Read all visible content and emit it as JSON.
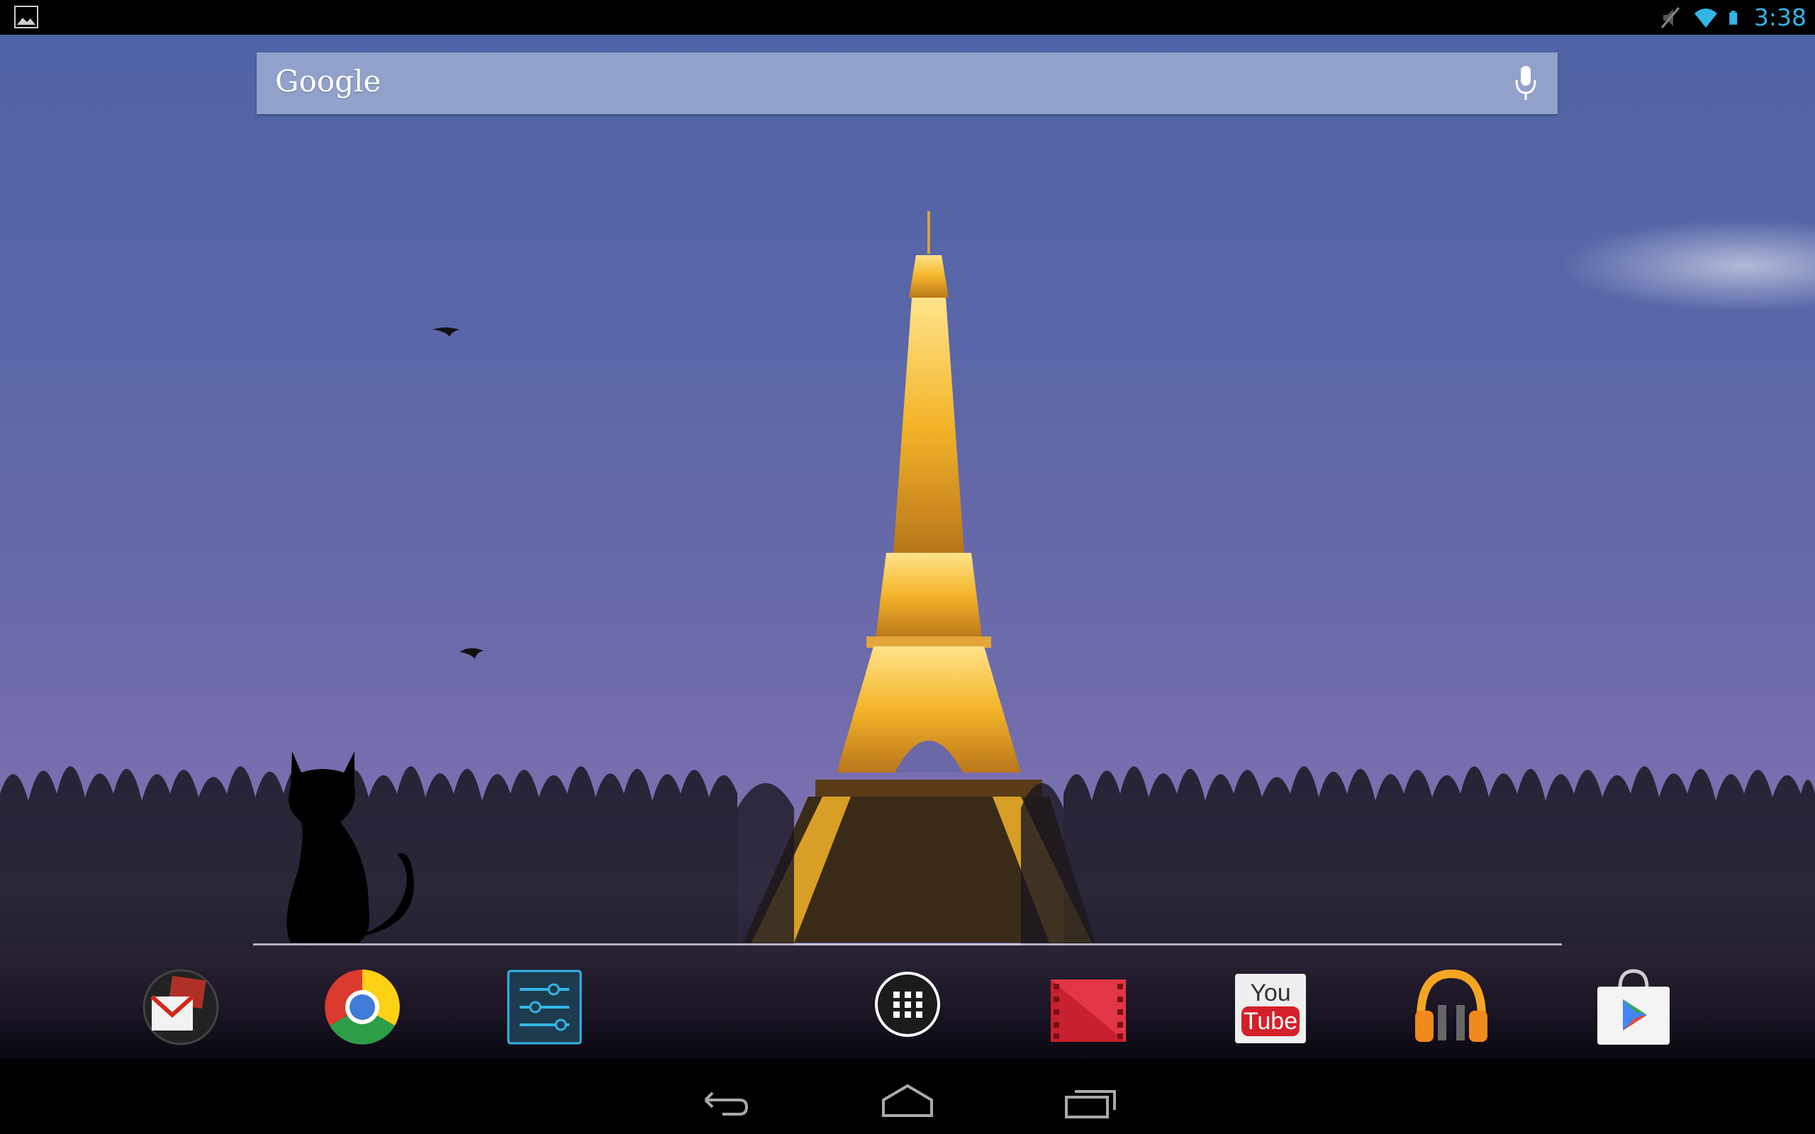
{
  "status_bar": {
    "time": "3:38",
    "icons": [
      "picture-notification-icon",
      "mute-icon",
      "wifi-icon",
      "battery-icon"
    ],
    "clock_color": "#33b5e5"
  },
  "search": {
    "logo_text": "Google",
    "icon": "mic-icon"
  },
  "dock": {
    "apps": [
      {
        "name": "gmail-app-icon"
      },
      {
        "name": "chrome-app-icon"
      },
      {
        "name": "settings-app-icon"
      },
      {
        "name": "all-apps-icon"
      },
      {
        "name": "play-movies-app-icon"
      },
      {
        "name": "youtube-app-icon",
        "label_top": "You",
        "label_bottom": "Tube"
      },
      {
        "name": "play-music-app-icon"
      },
      {
        "name": "play-store-app-icon"
      }
    ]
  },
  "nav": {
    "buttons": [
      "back-icon",
      "home-icon",
      "recent-apps-icon"
    ]
  },
  "colors": {
    "sky_top": "#4e64a6",
    "sky_bottom": "#7a70b0",
    "tower": "#f3b429",
    "accent": "#33b5e5"
  }
}
